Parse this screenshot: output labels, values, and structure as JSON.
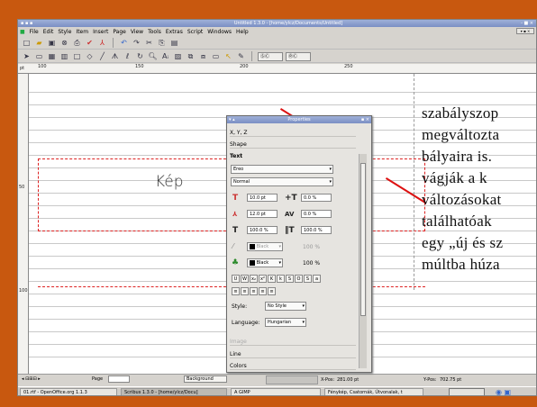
{
  "window": {
    "title": "Untitled 1.3.0 - [home/ylcz/Documents/Untitled]",
    "controls": "- ■ ×"
  },
  "menubar": {
    "items": [
      "File",
      "Edit",
      "Style",
      "Item",
      "Insert",
      "Page",
      "View",
      "Tools",
      "Extras",
      "Script",
      "Windows",
      "Help"
    ]
  },
  "toolbar": {
    "zoom_value": "ⓈⒸ",
    "line_tool_label": "ⓇⒸ"
  },
  "ruler": {
    "h_labels": [
      "100",
      "150",
      "200",
      "250"
    ],
    "v_labels": [
      "50",
      "100"
    ],
    "corner": "pt"
  },
  "canvas": {
    "image_frame_label": "Kép",
    "text_lines": [
      "szabályszop",
      "megváltozta",
      "bályaira is.",
      "vágják a k",
      "változásokat",
      "találhatóak",
      "egy „új és sz",
      "múltba húza"
    ]
  },
  "properties": {
    "title": "Properties",
    "sections": {
      "xyz": "X, Y, Z",
      "shape": "Shape",
      "text": "Text",
      "image": "Image",
      "line": "Line",
      "colors": "Colors"
    },
    "font_value": "Ereo",
    "font_style": "Normal",
    "font_size": "10.0 pt",
    "tracking": "0.0 %",
    "line_spacing": "12.0 pt",
    "kerning": "0.0 %",
    "scale_w": "100.0 %",
    "scale_h": "100.0 %",
    "stroke_color": "Black",
    "fill_color": "Black",
    "fill_shade": "100 %",
    "stroke_shade": "100 %",
    "style_label": "Style:",
    "style_value": "No Style",
    "language_label": "Language:",
    "language_value": "Hungarian"
  },
  "statusbar": {
    "xpos_label": "X-Pos:",
    "xpos_value": "281.00 pt",
    "ypos_label": "Y-Pos:",
    "ypos_value": "702.75 pt",
    "page_field": "Page",
    "layer": "Background"
  },
  "taskbar": {
    "items": [
      "01.rtf - OpenOffice.org 1.1.3",
      "Scribus 1.3.0 - [home/ylcz/Docu]",
      "A GIMP",
      "Fénykép, Csatornák, Útvonalak, t"
    ]
  }
}
